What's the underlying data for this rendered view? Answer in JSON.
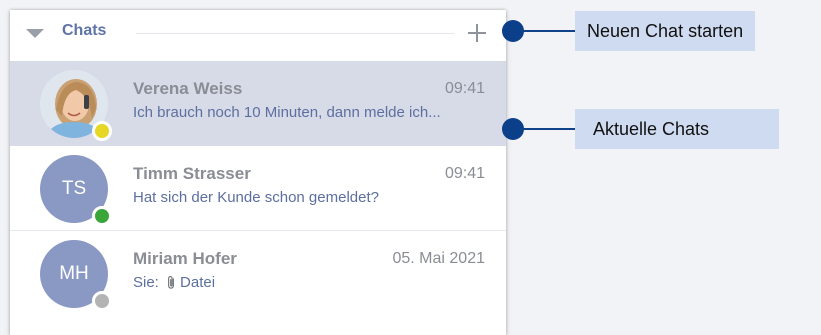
{
  "panel": {
    "title": "Chats"
  },
  "chats": [
    {
      "name": "Verena Weiss",
      "time": "09:41",
      "preview": "Ich brauch noch 10 Minuten, dann melde ich...",
      "avatar": "photo",
      "status_color": "#e6d626",
      "selected": true
    },
    {
      "name": "Timm Strasser",
      "time": "09:41",
      "preview": "Hat sich der Kunde schon gemeldet?",
      "initials": "TS",
      "status_color": "#3aa63a",
      "selected": false
    },
    {
      "name": "Miriam Hofer",
      "time": "05. Mai 2021",
      "sender": "Sie:",
      "attachment_icon": "paperclip-icon",
      "preview": "Datei",
      "initials": "MH",
      "status_color": "#b3b3b3",
      "selected": false
    }
  ],
  "callouts": [
    {
      "label": "Neuen Chat starten"
    },
    {
      "label": "Aktuelle Chats"
    }
  ],
  "colors": {
    "accent": "#5f74a6",
    "selected_bg": "#d7dbe8",
    "callout_bg": "#cfdbf0",
    "callout_marker": "#0b3f8a",
    "avatar_bg": "#8a98c4"
  }
}
